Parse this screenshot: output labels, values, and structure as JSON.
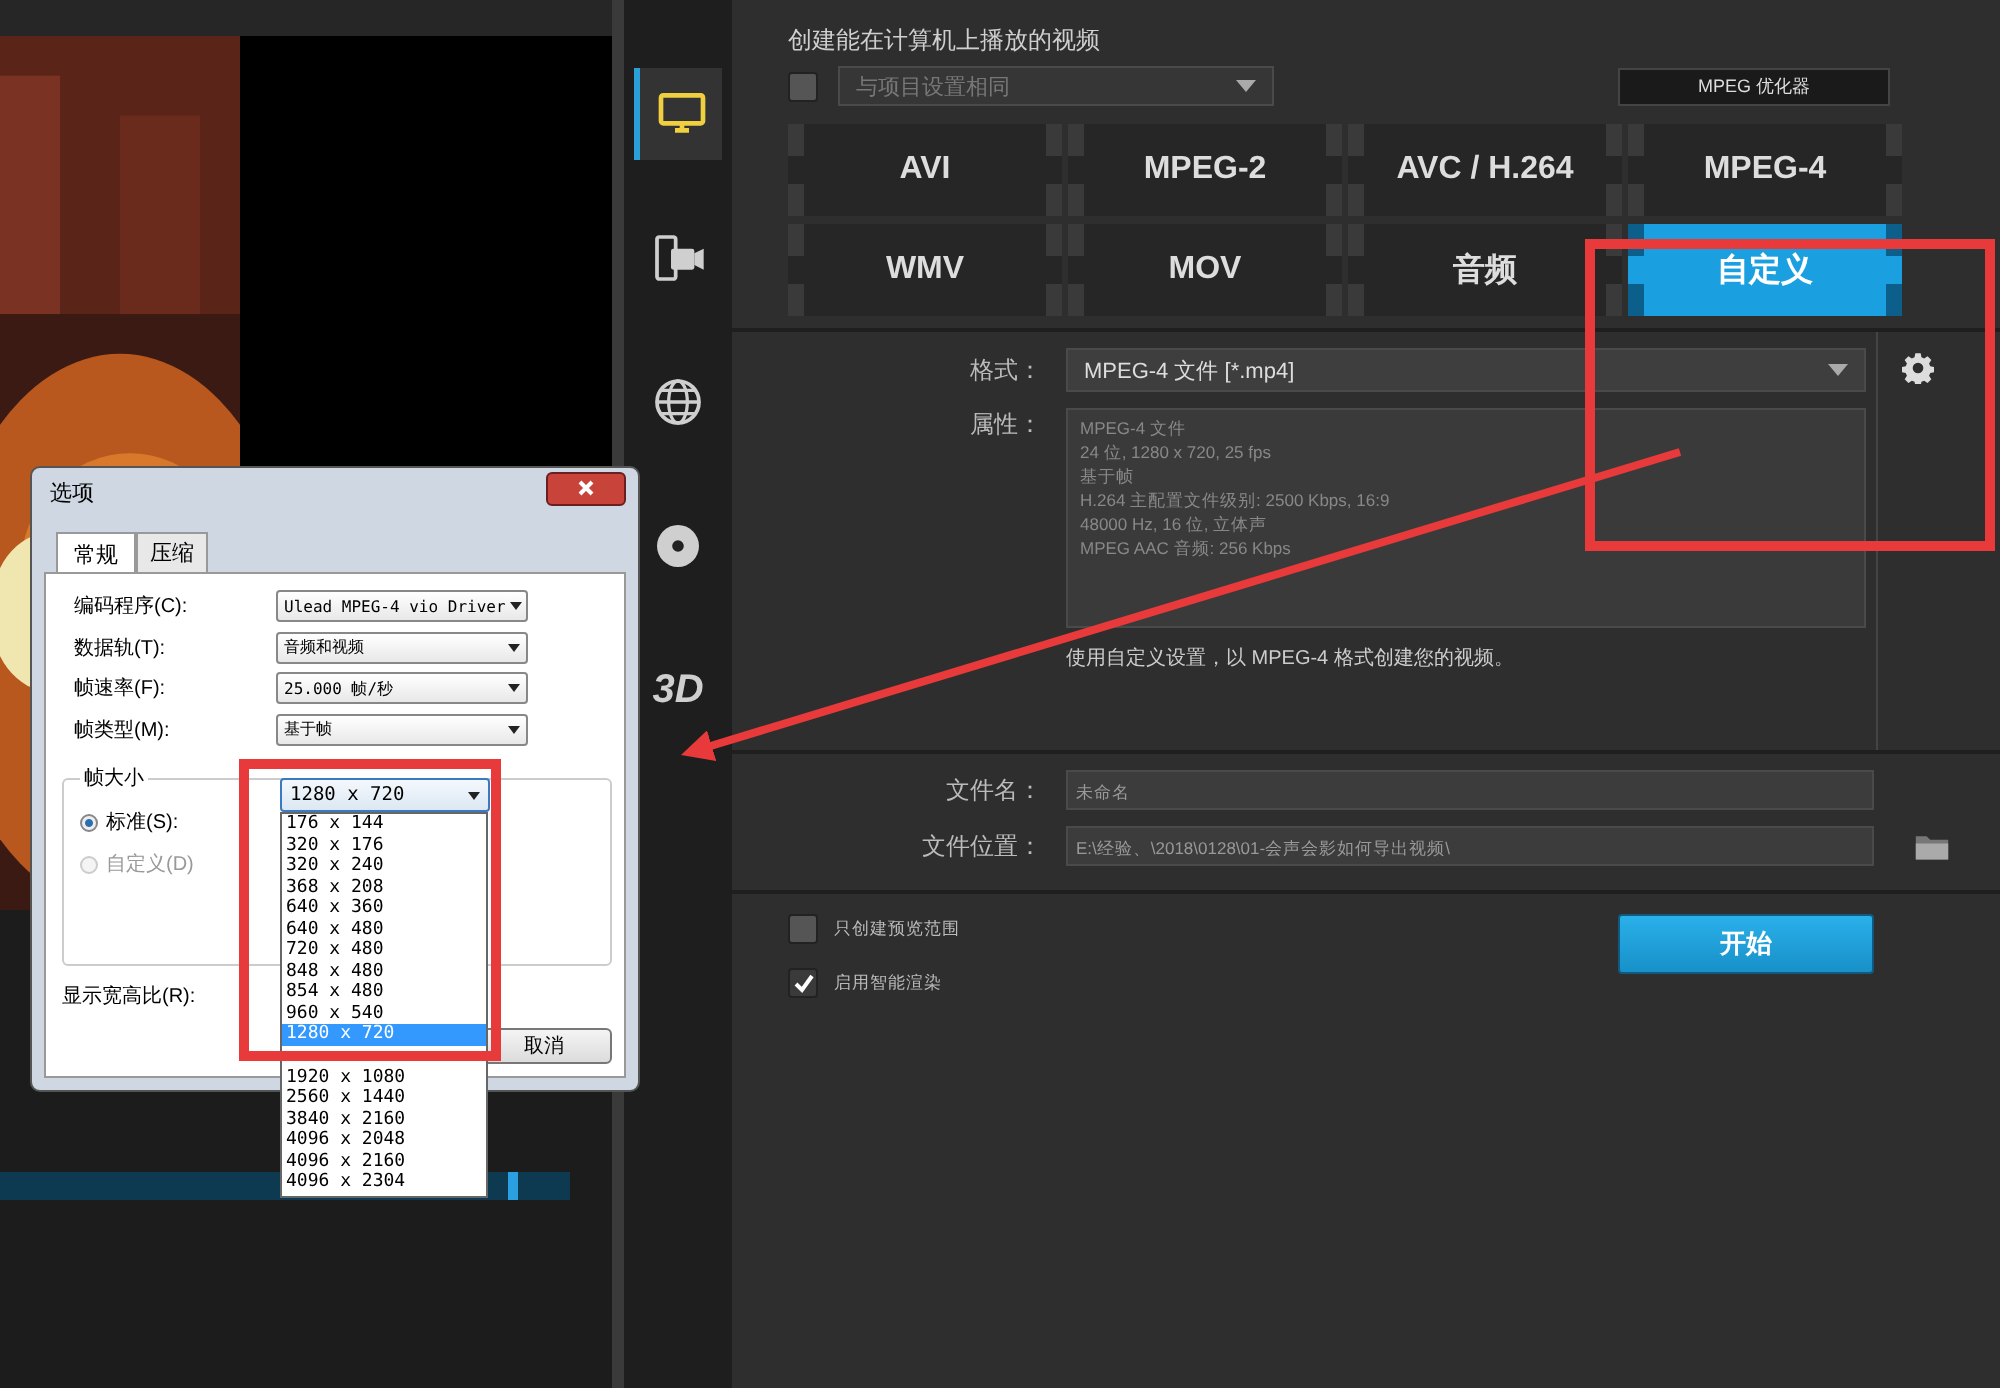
{
  "sidebar": {
    "items": [
      {
        "kind": "monitor",
        "selected": true
      },
      {
        "kind": "devices",
        "selected": false
      },
      {
        "kind": "globe",
        "selected": false
      },
      {
        "kind": "disc",
        "selected": false
      },
      {
        "kind": "glyph",
        "glyph": "3D",
        "selected": false
      }
    ]
  },
  "header": "创建能在计算机上播放的视频",
  "match_project": {
    "checked": false,
    "value": "与项目设置相同",
    "disabled": true
  },
  "optimizer_button": "MPEG 优化器",
  "formats": [
    {
      "label": "AVI",
      "selected": false
    },
    {
      "label": "MPEG-2",
      "selected": false
    },
    {
      "label": "AVC / H.264",
      "selected": false
    },
    {
      "label": "MPEG-4",
      "selected": false
    },
    {
      "label": "WMV",
      "selected": false
    },
    {
      "label": "MOV",
      "selected": false
    },
    {
      "label": "音频",
      "selected": false
    },
    {
      "label": "自定义",
      "selected": true
    }
  ],
  "format_field": {
    "label": "格式：",
    "value": "MPEG-4 文件 [*.mp4]"
  },
  "properties": {
    "label": "属性：",
    "lines": [
      "MPEG-4 文件",
      "24 位, 1280 x 720, 25 fps",
      "基于帧",
      "H.264 主配置文件级别: 2500 Kbps, 16:9",
      "48000 Hz, 16 位, 立体声",
      "MPEG AAC 音频: 256 Kbps"
    ]
  },
  "description": "使用自定义设置，以 MPEG-4 格式创建您的视频。",
  "file_name": {
    "label": "文件名：",
    "value": "未命名"
  },
  "file_location": {
    "label": "文件位置：",
    "value": "E:\\经验、\\2018\\0128\\01-会声会影如何导出视频\\"
  },
  "options": [
    {
      "label": "只创建预览范围",
      "checked": false
    },
    {
      "label": "启用智能渲染",
      "checked": true
    }
  ],
  "start_button": "开始",
  "dialog": {
    "title": "选项",
    "tabs": [
      {
        "label": "常规",
        "selected": true
      },
      {
        "label": "压缩",
        "selected": false
      }
    ],
    "fields": [
      {
        "label": "编码程序(C):",
        "value": "Ulead MPEG-4 vio Driver"
      },
      {
        "label": "数据轨(T):",
        "value": "音频和视频"
      },
      {
        "label": "帧速率(F):",
        "value": "25.000 帧/秒"
      },
      {
        "label": "帧类型(M):",
        "value": "基于帧"
      }
    ],
    "frame_size": {
      "title": "帧大小",
      "radios": [
        {
          "label": "标准(S):",
          "selected": true,
          "disabled": false
        },
        {
          "label": "自定义(D)",
          "selected": false,
          "disabled": true
        }
      ],
      "value": "1280 x 720",
      "options": [
        {
          "label": "176 x 144",
          "selected": false
        },
        {
          "label": "320 x 176",
          "selected": false
        },
        {
          "label": "320 x 240",
          "selected": false
        },
        {
          "label": "368 x 208",
          "selected": false
        },
        {
          "label": "640 x 360",
          "selected": false
        },
        {
          "label": "640 x 480",
          "selected": false
        },
        {
          "label": "720 x 480",
          "selected": false
        },
        {
          "label": "848 x 480",
          "selected": false
        },
        {
          "label": "854 x 480",
          "selected": false
        },
        {
          "label": "960 x 540",
          "selected": false
        },
        {
          "label": "1280 x 720",
          "selected": true
        },
        {
          "label": "1920 x 1080",
          "selected": false
        },
        {
          "label": "2560 x 1440",
          "selected": false
        },
        {
          "label": "3840 x 2160",
          "selected": false
        },
        {
          "label": "4096 x 2048",
          "selected": false
        },
        {
          "label": "4096 x 2160",
          "selected": false
        },
        {
          "label": "4096 x 2304",
          "selected": false
        }
      ]
    },
    "aspect_label": "显示宽高比(R):",
    "buttons": [
      "取消"
    ]
  }
}
